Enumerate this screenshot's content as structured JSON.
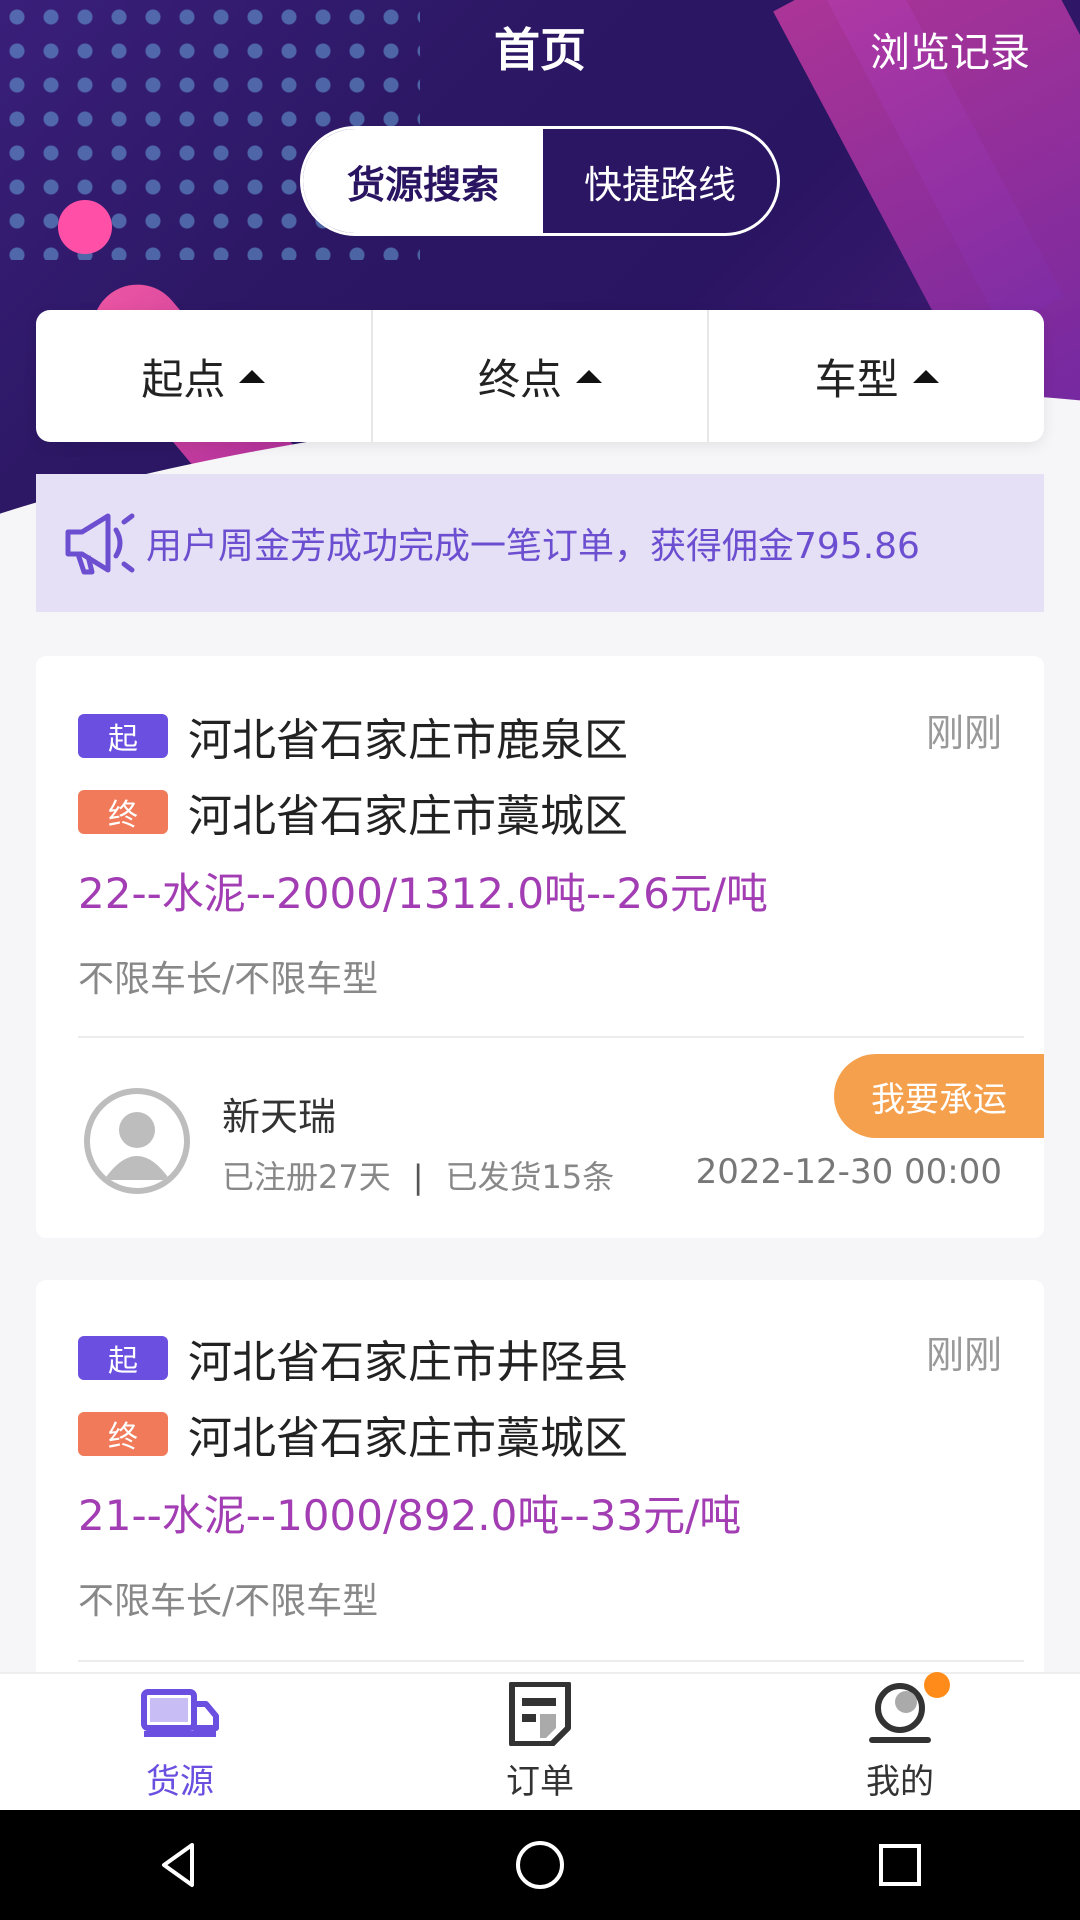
{
  "header": {
    "title": "首页",
    "history_label": "浏览记录"
  },
  "segment": {
    "active": "货源搜索",
    "inactive": "快捷路线"
  },
  "filters": [
    {
      "label": "起点"
    },
    {
      "label": "终点"
    },
    {
      "label": "车型"
    }
  ],
  "notice": {
    "text": "用户周金芳成功完成一笔订单，获得佣金795.86",
    "icon": "megaphone-icon"
  },
  "cards": [
    {
      "start_tag": "起",
      "start": "河北省石家庄市鹿泉区",
      "end_tag": "终",
      "end": "河北省石家庄市藁城区",
      "time": "刚刚",
      "goods": "22--水泥--2000/1312.0吨--26元/吨",
      "requirement": "不限车长/不限车型",
      "shipper": "新天瑞",
      "registered": "已注册27天",
      "separator": "|",
      "shipped": "已发货15条",
      "date": "2022-12-30 00:00",
      "accept_label": "我要承运"
    },
    {
      "start_tag": "起",
      "start": "河北省石家庄市井陉县",
      "end_tag": "终",
      "end": "河北省石家庄市藁城区",
      "time": "刚刚",
      "goods": "21--水泥--1000/892.0吨--33元/吨",
      "requirement": "不限车长/不限车型"
    }
  ],
  "tabbar": [
    {
      "label": "货源",
      "icon": "truck-icon",
      "active": true
    },
    {
      "label": "订单",
      "icon": "order-icon",
      "active": false
    },
    {
      "label": "我的",
      "icon": "profile-icon",
      "active": false
    }
  ],
  "colors": {
    "accent": "#6b4fe0",
    "goods": "#a23db3",
    "accept": "#f5a04d",
    "end_tag": "#f07a5a"
  }
}
